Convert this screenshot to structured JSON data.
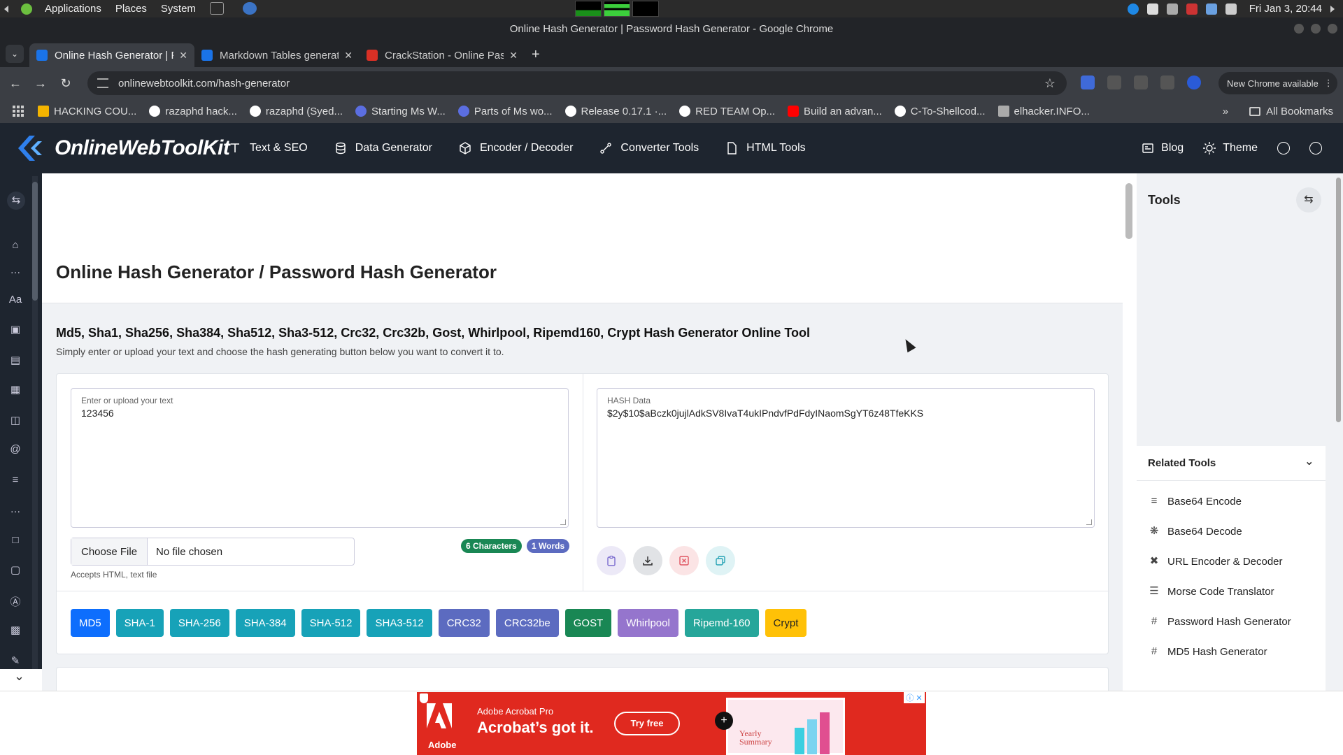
{
  "os": {
    "menu": [
      "Applications",
      "Places",
      "System"
    ],
    "clock": "Fri Jan 3, 20:44"
  },
  "window": {
    "title": "Online Hash Generator | Password Hash Generator - Google Chrome"
  },
  "tabs": [
    {
      "label": "Online Hash Generator | Passw",
      "color": "#1a73e8",
      "active": true
    },
    {
      "label": "Markdown Tables generator",
      "color": "#1a73e8",
      "active": false
    },
    {
      "label": "CrackStation - Online Pass",
      "color": "#d93025",
      "active": false
    }
  ],
  "address": {
    "url": "onlinewebtoolkit.com/hash-generator",
    "new_chrome": "New Chrome available"
  },
  "bookmarks": {
    "items": [
      {
        "label": "HACKING COU...",
        "color": "#f4b400"
      },
      {
        "label": "razaphd hack...",
        "color": "#ffffff"
      },
      {
        "label": "razaphd (Syed...",
        "color": "#ffffff"
      },
      {
        "label": "Starting Ms W...",
        "color": "#5b6ee1"
      },
      {
        "label": "Parts of Ms wo...",
        "color": "#5b6ee1"
      },
      {
        "label": "Release 0.17.1 ·...",
        "color": "#ffffff"
      },
      {
        "label": "RED TEAM Op...",
        "color": "#ffffff"
      },
      {
        "label": "Build an advan...",
        "color": "#ff0000"
      },
      {
        "label": "C-To-Shellcod...",
        "color": "#ffffff"
      },
      {
        "label": "elhacker.INFO...",
        "color": "#aaaaaa"
      }
    ],
    "more": "»",
    "all_bookmarks": "All Bookmarks"
  },
  "site": {
    "brand": "OnlineWebToolKit",
    "nav": [
      "Text & SEO",
      "Data Generator",
      "Encoder / Decoder",
      "Converter Tools",
      "HTML Tools"
    ],
    "blog": "Blog",
    "theme": "Theme"
  },
  "page": {
    "title": "Online Hash Generator / Password Hash Generator",
    "subtitle": "Md5, Sha1, Sha256, Sha384, Sha512, Sha3-512, Crc32, Crc32b, Gost, Whirlpool, Ripemd160, Crypt Hash Generator Online Tool",
    "description": "Simply enter or upload your text and choose the hash generating button below you want to convert it to."
  },
  "input": {
    "label": "Enter or upload your text",
    "value": "123456",
    "choose_file": "Choose File",
    "no_file": "No file chosen",
    "accepts": "Accepts HTML, text file",
    "chars_badge": "6 Characters",
    "words_badge": "1 Words"
  },
  "output": {
    "label": "HASH Data",
    "value": "$2y$10$aBczk0jujlAdkSV8IvaT4ukIPndvfPdFdyINaomSgYT6z48TfeKKS"
  },
  "hash_buttons": [
    {
      "label": "MD5",
      "color": "#0d6efd"
    },
    {
      "label": "SHA-1",
      "color": "#17a2b8"
    },
    {
      "label": "SHA-256",
      "color": "#17a2b8"
    },
    {
      "label": "SHA-384",
      "color": "#17a2b8"
    },
    {
      "label": "SHA-512",
      "color": "#17a2b8"
    },
    {
      "label": "SHA3-512",
      "color": "#17a2b8"
    },
    {
      "label": "CRC32",
      "color": "#5c6bc0"
    },
    {
      "label": "CRC32be",
      "color": "#5c6bc0"
    },
    {
      "label": "GOST",
      "color": "#198754"
    },
    {
      "label": "Whirlpool",
      "color": "#9575cd"
    },
    {
      "label": "Ripemd-160",
      "color": "#26a69a"
    },
    {
      "label": "Crypt",
      "color": "#ffc107"
    }
  ],
  "sidebar": {
    "title": "Tools",
    "related_title": "Related Tools",
    "related": [
      {
        "label": "Base64 Encode",
        "icon": "base64-encode-icon"
      },
      {
        "label": "Base64 Decode",
        "icon": "base64-decode-icon"
      },
      {
        "label": "URL Encoder & Decoder",
        "icon": "url-encoder-icon"
      },
      {
        "label": "Morse Code Translator",
        "icon": "morse-code-icon"
      },
      {
        "label": "Password Hash Generator",
        "icon": "hash-icon"
      },
      {
        "label": "MD5 Hash Generator",
        "icon": "hash-icon"
      }
    ]
  },
  "ad": {
    "brand": "Adobe",
    "product": "Adobe Acrobat Pro",
    "headline": "Acrobat’s got it.",
    "cta": "Try free",
    "shot_text": "Yearly Summary"
  }
}
